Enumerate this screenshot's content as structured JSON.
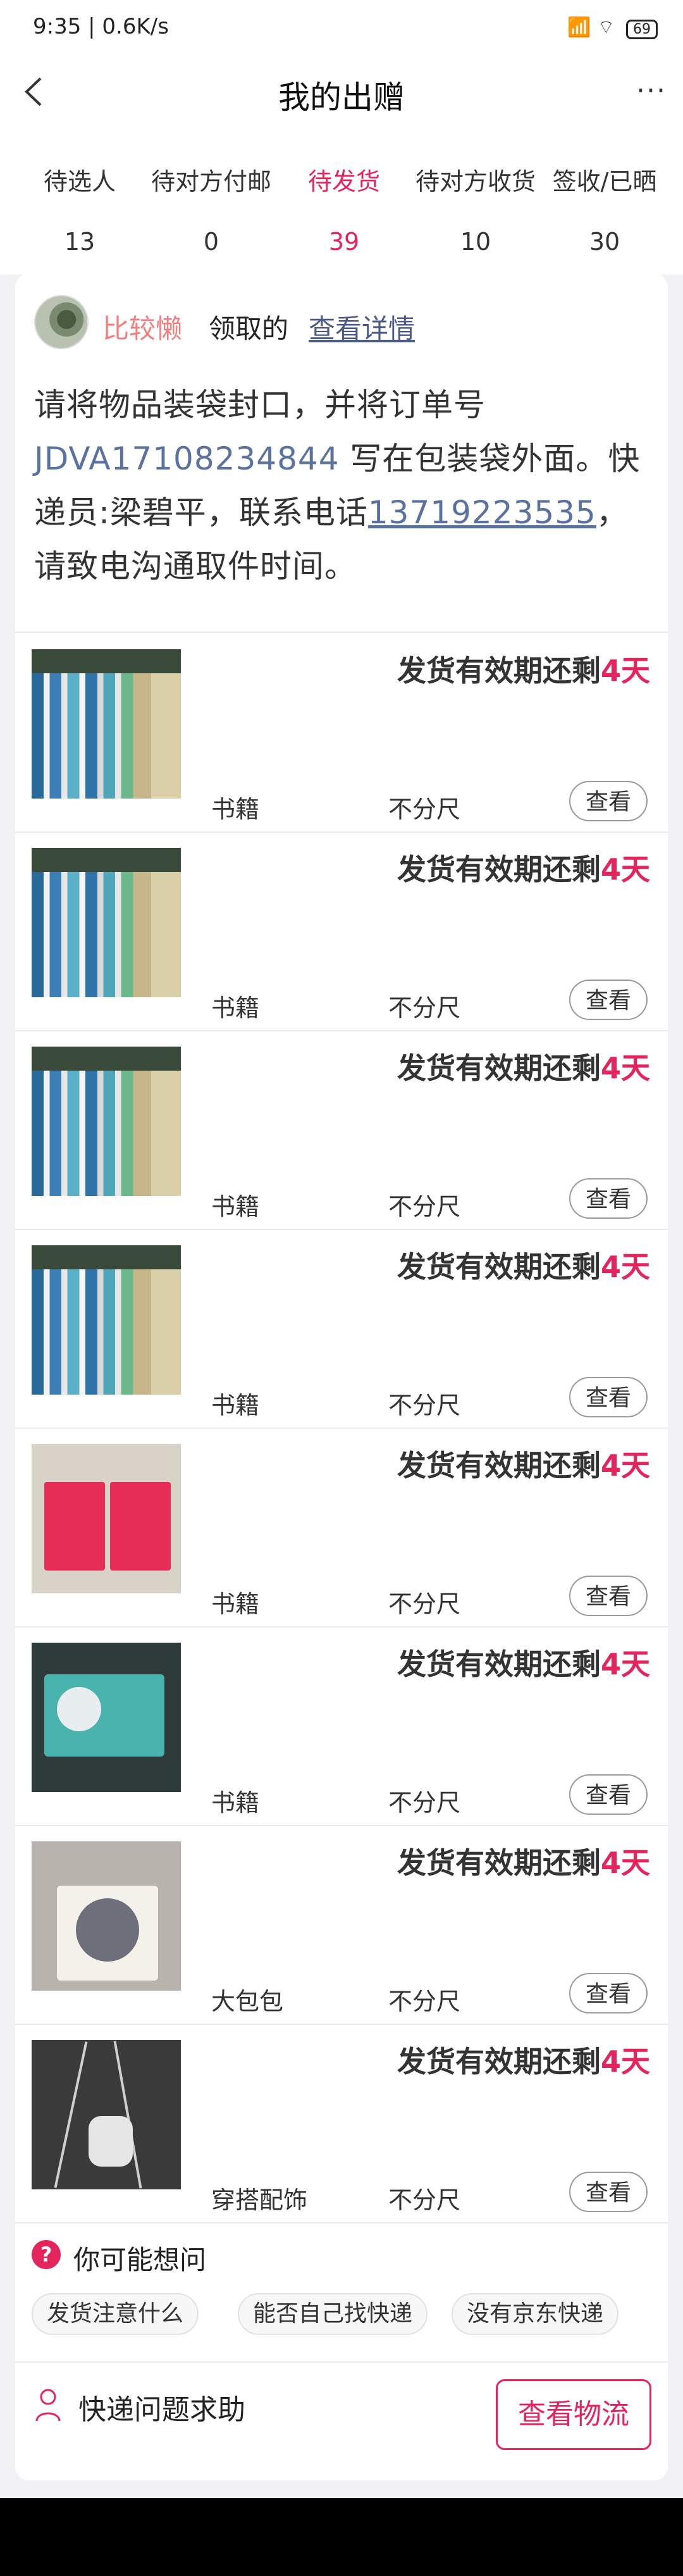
{
  "status_bar": {
    "time": "9:35 | 0.6K/s",
    "icons": "⚡ ⏰",
    "right_icons": "📶 ⌔",
    "battery": "69"
  },
  "header": {
    "title": "我的出赠",
    "more_icon": "more-dots-icon",
    "more": "···"
  },
  "tabs": [
    {
      "label": "待选人",
      "count": "13"
    },
    {
      "label": "待对方付邮",
      "count": "0"
    },
    {
      "label": "待发货",
      "count": "39",
      "active": true
    },
    {
      "label": "待对方收货",
      "count": "10"
    },
    {
      "label": "签收/已晒",
      "count": "30"
    }
  ],
  "receiver": {
    "name": "比较懒",
    "action": "领取的",
    "detail_link": "查看详情"
  },
  "notice": {
    "part1": "请将物品装袋封口，并将订单号 ",
    "order_no": "JDVA17108234844",
    "part2": " 写在包装袋外面。快递员:梁碧平，联系电话",
    "phone": "13719223535",
    "part3": "，请致电沟通取件时间。"
  },
  "items": [
    {
      "expire_prefix": "发货有效期还剩",
      "days": "4天",
      "category": "书籍",
      "size": "不分尺",
      "view": "查看",
      "thumb": "books"
    },
    {
      "expire_prefix": "发货有效期还剩",
      "days": "4天",
      "category": "书籍",
      "size": "不分尺",
      "view": "查看",
      "thumb": "books"
    },
    {
      "expire_prefix": "发货有效期还剩",
      "days": "4天",
      "category": "书籍",
      "size": "不分尺",
      "view": "查看",
      "thumb": "books"
    },
    {
      "expire_prefix": "发货有效期还剩",
      "days": "4天",
      "category": "书籍",
      "size": "不分尺",
      "view": "查看",
      "thumb": "books"
    },
    {
      "expire_prefix": "发货有效期还剩",
      "days": "4天",
      "category": "书籍",
      "size": "不分尺",
      "view": "查看",
      "thumb": "red-books"
    },
    {
      "expire_prefix": "发货有效期还剩",
      "days": "4天",
      "category": "书籍",
      "size": "不分尺",
      "view": "查看",
      "thumb": "teal-box"
    },
    {
      "expire_prefix": "发货有效期还剩",
      "days": "4天",
      "category": "大包包",
      "size": "不分尺",
      "view": "查看",
      "thumb": "tote-bag"
    },
    {
      "expire_prefix": "发货有效期还剩",
      "days": "4天",
      "category": "穿搭配饰",
      "size": "不分尺",
      "view": "查看",
      "thumb": "necklace"
    }
  ],
  "faq": {
    "title": "你可能想问",
    "chips": [
      "发货注意什么",
      "能否自己找快递",
      "没有京东快递"
    ]
  },
  "help": {
    "label": "快递问题求助",
    "button": "查看物流"
  },
  "colors": {
    "accent": "#e4245c",
    "link": "#5a72a0",
    "receiver_name": "#f08080"
  }
}
